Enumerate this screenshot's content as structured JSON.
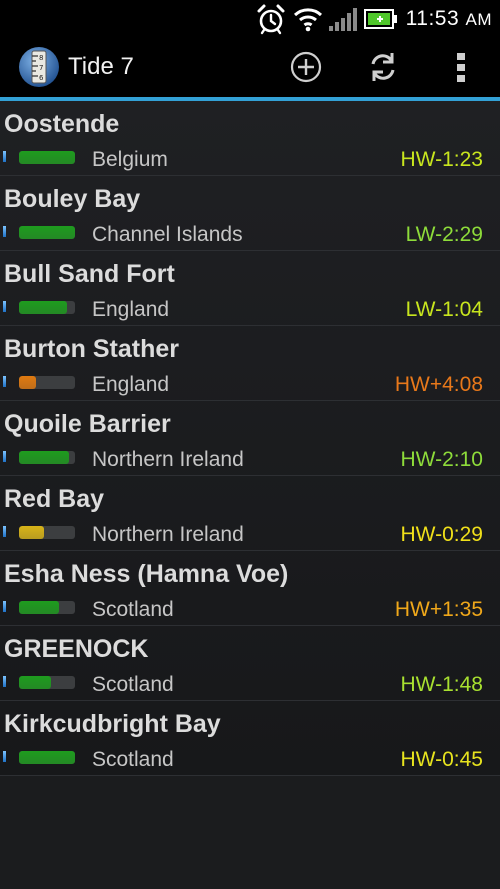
{
  "status_bar": {
    "time": "11:53",
    "ampm": "AM",
    "icons": [
      "alarm-icon",
      "wifi-icon",
      "signal-icon",
      "battery-icon"
    ]
  },
  "app": {
    "title": "Tide 7",
    "icon": "tide-gauge-icon",
    "actions": [
      "add-icon",
      "refresh-icon",
      "overflow-menu-icon"
    ]
  },
  "colors": {
    "accent": "#33a1d6",
    "bar_green": "#1e9c1e",
    "bar_orange": "#e07a10"
  },
  "locations": [
    {
      "name": "Oostende",
      "country": "Belgium",
      "tide": "HW-1:23",
      "time_color": "#c8e61e",
      "fill_pct": 100,
      "bar_color": "#1e9c1e"
    },
    {
      "name": "Bouley Bay",
      "country": "Channel Islands",
      "tide": "LW-2:29",
      "time_color": "#8edc3a",
      "fill_pct": 100,
      "bar_color": "#1e9c1e"
    },
    {
      "name": "Bull Sand Fort",
      "country": "England",
      "tide": "LW-1:04",
      "time_color": "#c8e61e",
      "fill_pct": 86,
      "bar_color": "#1e9c1e"
    },
    {
      "name": "Burton Stather",
      "country": "England",
      "tide": "HW+4:08",
      "time_color": "#e8781a",
      "fill_pct": 30,
      "bar_color": "#e07a10"
    },
    {
      "name": "Quoile Barrier",
      "country": "Northern Ireland",
      "tide": "HW-2:10",
      "time_color": "#8edc3a",
      "fill_pct": 90,
      "bar_color": "#1e9c1e"
    },
    {
      "name": "Red Bay",
      "country": "Northern Ireland",
      "tide": "HW-0:29",
      "time_color": "#f0e01a",
      "fill_pct": 44,
      "bar_color": "#d8b418"
    },
    {
      "name": "Esha Ness (Hamna Voe)",
      "country": "Scotland",
      "tide": "HW+1:35",
      "time_color": "#f0a81a",
      "fill_pct": 72,
      "bar_color": "#1e9c1e"
    },
    {
      "name": "GREENOCK",
      "country": "Scotland",
      "tide": "HW-1:48",
      "time_color": "#a8e030",
      "fill_pct": 58,
      "bar_color": "#1e9c1e"
    },
    {
      "name": "Kirkcudbright Bay",
      "country": "Scotland",
      "tide": "HW-0:45",
      "time_color": "#e8e41e",
      "fill_pct": 100,
      "bar_color": "#1e9c1e"
    }
  ]
}
